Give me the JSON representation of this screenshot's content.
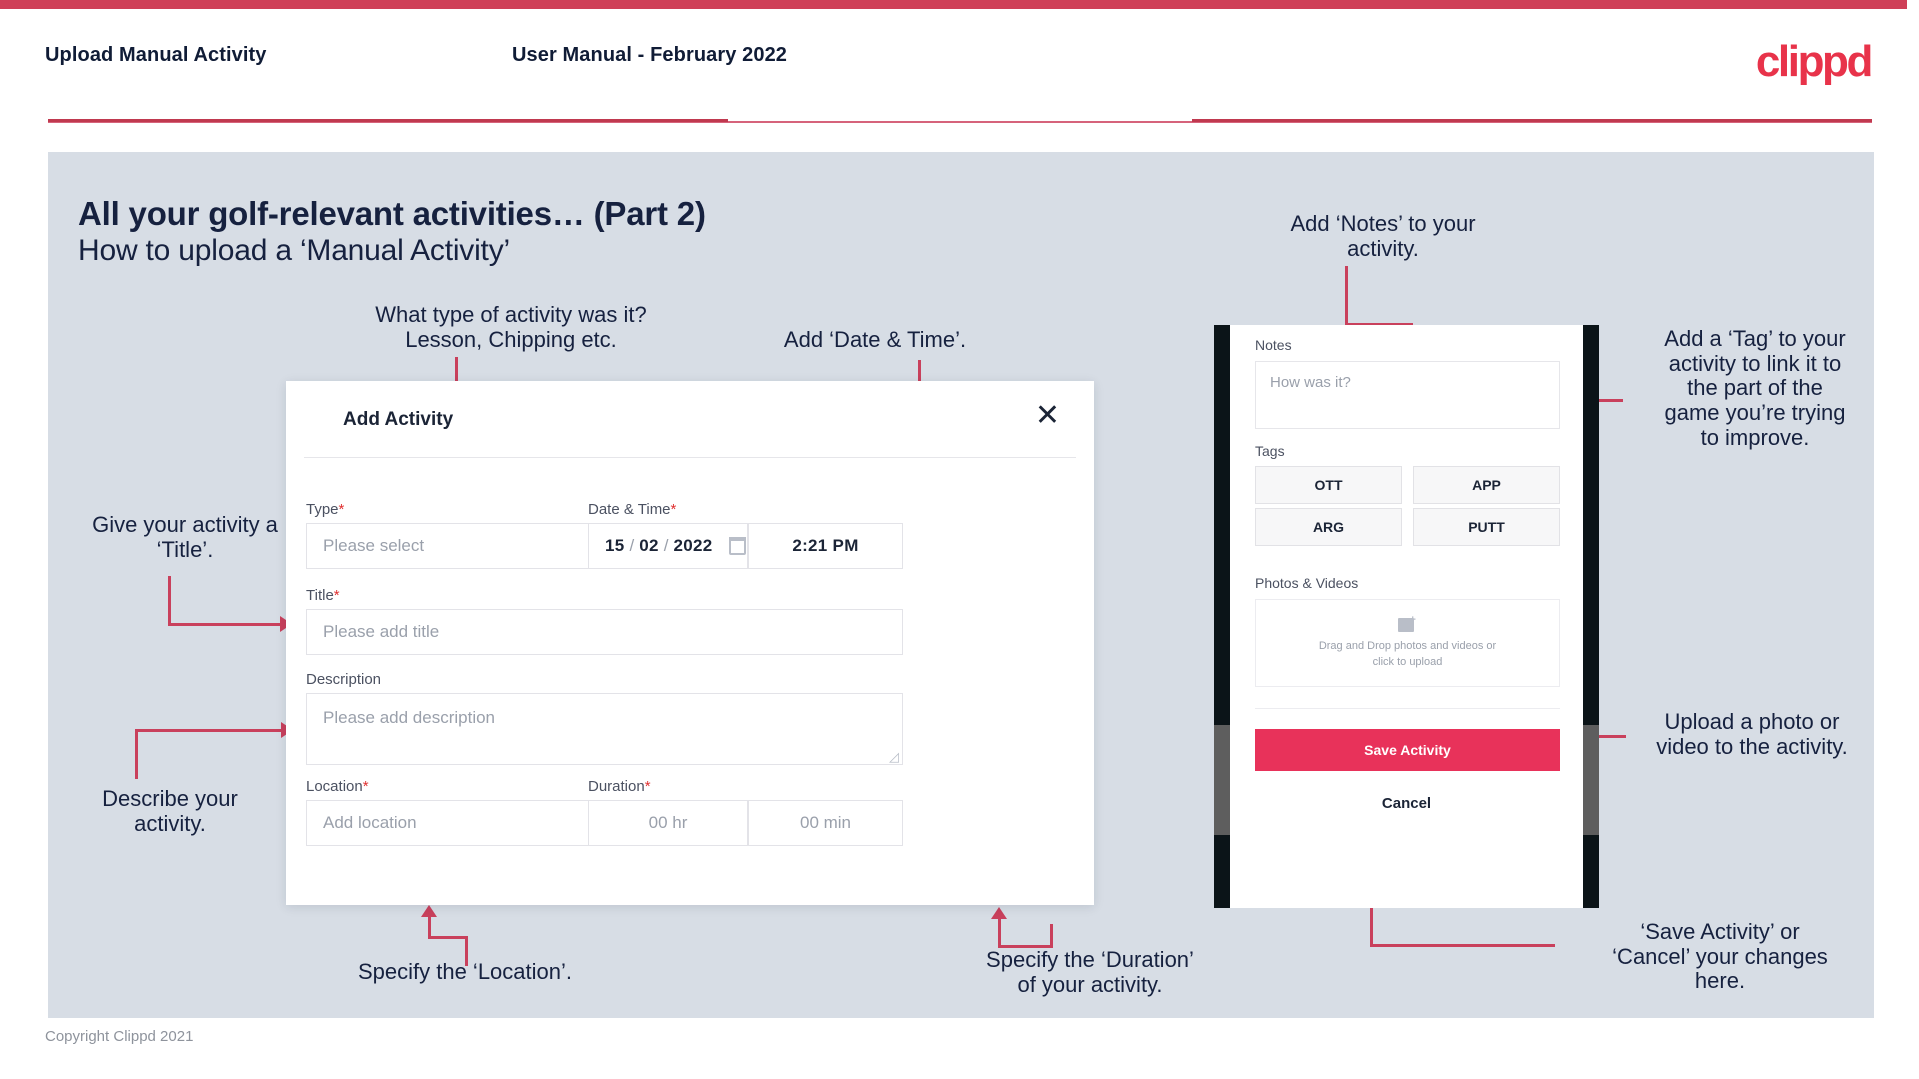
{
  "header": {
    "left_title": "Upload Manual Activity",
    "center_title": "User Manual - February 2022",
    "logo": "clippd"
  },
  "slide": {
    "title_main": "All your golf-relevant activities… (Part 2)",
    "title_sub": "How to upload a ‘Manual Activity’"
  },
  "annotations": {
    "type": "What type of activity was it?\nLesson, Chipping etc.",
    "datetime": "Add ‘Date & Time’.",
    "title": "Give your activity a\n‘Title’.",
    "description": "Describe your\nactivity.",
    "location": "Specify the ‘Location’.",
    "duration": "Specify the ‘Duration’\nof your activity.",
    "notes": "Add ‘Notes’ to your\nactivity.",
    "tags": "Add a ‘Tag’ to your\nactivity to link it to\nthe part of the\ngame you’re trying\nto improve.",
    "photos": "Upload a photo or\nvideo to the activity.",
    "save": "‘Save Activity’ or\n‘Cancel’ your changes\nhere."
  },
  "dialog": {
    "title": "Add Activity",
    "close_icon": "close-icon",
    "fields": {
      "type": {
        "label": "Type",
        "required": "*",
        "placeholder": "Please select",
        "chevron_icon": "chevron-down-icon"
      },
      "datetime": {
        "label": "Date & Time",
        "required": "*",
        "day": "15",
        "sep1": "/",
        "month": "02",
        "sep2": "/",
        "year": "2022",
        "calendar_icon": "calendar-icon",
        "time": "2:21 PM"
      },
      "title": {
        "label": "Title",
        "required": "*",
        "placeholder": "Please add title"
      },
      "description": {
        "label": "Description",
        "required": "",
        "placeholder": "Please add description"
      },
      "location": {
        "label": "Location",
        "required": "*",
        "placeholder": "Add location"
      },
      "duration": {
        "label": "Duration",
        "required": "*",
        "hours_placeholder": "00 hr",
        "minutes_placeholder": "00 min"
      }
    }
  },
  "phone": {
    "notes": {
      "label": "Notes",
      "placeholder": "How was it?"
    },
    "tags": {
      "label": "Tags",
      "items": [
        "OTT",
        "APP",
        "ARG",
        "PUTT"
      ]
    },
    "photos": {
      "label": "Photos & Videos",
      "upload_icon": "add-image-icon",
      "hint_line1": "Drag and Drop photos and videos or",
      "hint_line2": "click to upload"
    },
    "save_label": "Save Activity",
    "cancel_label": "Cancel"
  },
  "footer": {
    "copyright": "Copyright Clippd 2021"
  },
  "colors": {
    "brand_crimson": "#e8334a",
    "accent_line": "#c9405c",
    "slide_bg": "#d7dde5",
    "text_dark": "#16213f",
    "save_button": "#e8325a"
  }
}
